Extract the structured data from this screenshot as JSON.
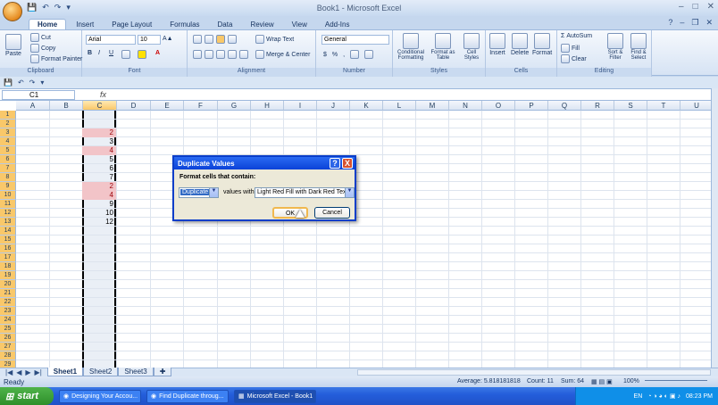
{
  "window": {
    "title": "Book1 - Microsoft Excel",
    "min": "–",
    "max": "□",
    "close": "✕"
  },
  "qat": [
    "💾",
    "↶",
    "↷",
    "▾"
  ],
  "tabs": [
    "Home",
    "Insert",
    "Page Layout",
    "Formulas",
    "Data",
    "Review",
    "View",
    "Add-Ins"
  ],
  "ribbon": {
    "clipboard": {
      "paste": "Paste",
      "cut": "Cut",
      "copy": "Copy",
      "format_painter": "Format Painter",
      "label": "Clipboard"
    },
    "font": {
      "name": "Arial",
      "size": "10",
      "bold": "B",
      "italic": "I",
      "underline": "U",
      "label": "Font"
    },
    "alignment": {
      "wrap": "Wrap Text",
      "merge": "Merge & Center",
      "label": "Alignment"
    },
    "number": {
      "format": "General",
      "currency": "$",
      "percent": "%",
      "comma": ",",
      "label": "Number"
    },
    "styles": {
      "conditional": "Conditional Formatting",
      "format_table": "Format as Table",
      "cell_styles": "Cell Styles",
      "label": "Styles"
    },
    "cells": {
      "insert": "Insert",
      "delete": "Delete",
      "format": "Format",
      "label": "Cells"
    },
    "editing": {
      "autosum": "AutoSum",
      "fill": "Fill",
      "clear": "Clear",
      "sort": "Sort & Filter",
      "find": "Find & Select",
      "label": "Editing"
    }
  },
  "formula_bar": {
    "name_box": "C1",
    "fx": "fx",
    "value": ""
  },
  "columns": [
    "A",
    "B",
    "C",
    "D",
    "E",
    "F",
    "G",
    "H",
    "I",
    "J",
    "K",
    "L",
    "M",
    "N",
    "O",
    "P",
    "Q",
    "R",
    "S",
    "T",
    "U"
  ],
  "rows": [
    "1",
    "2",
    "3",
    "4",
    "5",
    "6",
    "7",
    "8",
    "9",
    "10",
    "11",
    "12",
    "13",
    "14",
    "15",
    "16",
    "17",
    "18",
    "19",
    "20",
    "21",
    "22",
    "23",
    "24",
    "25",
    "26",
    "27",
    "28",
    "29"
  ],
  "cells": [
    {
      "row": 3,
      "value": "2",
      "dup": true
    },
    {
      "row": 4,
      "value": "3",
      "dup": false
    },
    {
      "row": 5,
      "value": "4",
      "dup": true
    },
    {
      "row": 6,
      "value": "5",
      "dup": false
    },
    {
      "row": 7,
      "value": "6",
      "dup": false
    },
    {
      "row": 8,
      "value": "7",
      "dup": false
    },
    {
      "row": 9,
      "value": "2",
      "dup": true
    },
    {
      "row": 10,
      "value": "4",
      "dup": true
    },
    {
      "row": 11,
      "value": "9",
      "dup": false
    },
    {
      "row": 12,
      "value": "10",
      "dup": false
    },
    {
      "row": 13,
      "value": "12",
      "dup": false
    }
  ],
  "dialog": {
    "title": "Duplicate Values",
    "help": "?",
    "close": "X",
    "prompt": "Format cells that contain:",
    "rule_type": "Duplicate",
    "middle_text": "values with",
    "format": "Light Red Fill with Dark Red Text",
    "ok": "OK",
    "cancel": "Cancel"
  },
  "sheets": [
    "Sheet1",
    "Sheet2",
    "Sheet3"
  ],
  "status": {
    "ready": "Ready",
    "average": "Average: 5.818181818",
    "count": "Count: 11",
    "sum": "Sum: 64",
    "zoom": "100%"
  },
  "taskbar": {
    "start": "start",
    "tasks": [
      "Designing Your Accou...",
      "Find Duplicate throug...",
      "Microsoft Excel - Book1"
    ],
    "lang": "EN",
    "time": "08:23 PM"
  },
  "colors": {
    "dup_fill": "#f2c4c8",
    "dup_text": "#9c0006",
    "accent": "#0a42d8"
  }
}
